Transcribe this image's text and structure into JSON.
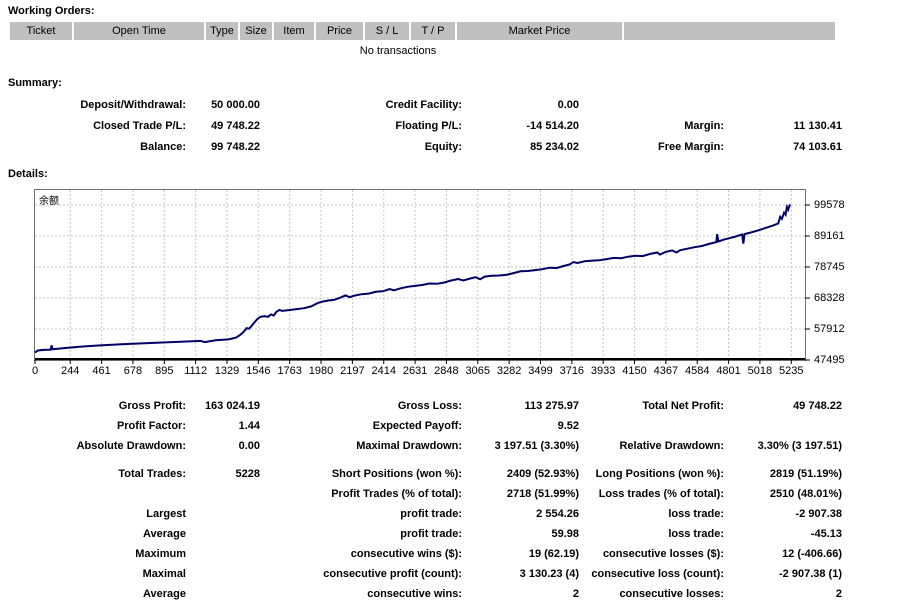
{
  "working_orders": {
    "section_label": "Working Orders:",
    "columns": [
      "Ticket",
      "Open Time",
      "Type",
      "Size",
      "Item",
      "Price",
      "S / L",
      "T / P",
      "Market Price",
      ""
    ],
    "empty_text": "No transactions"
  },
  "summary": {
    "section_label": "Summary:",
    "rows": [
      [
        "Deposit/Withdrawal:",
        "50 000.00",
        "Credit Facility:",
        "0.00",
        "",
        ""
      ],
      [
        "Closed Trade P/L:",
        "49 748.22",
        "Floating P/L:",
        "-14 514.20",
        "Margin:",
        "11 130.41"
      ],
      [
        "Balance:",
        "99 748.22",
        "Equity:",
        "85 234.02",
        "Free Margin:",
        "74 103.61"
      ]
    ]
  },
  "details": {
    "section_label": "Details:"
  },
  "chart_data": {
    "type": "line",
    "title": "",
    "legend": "余额",
    "line_color": "#000066",
    "grid": true,
    "legend_position": "top-left inside plot",
    "xlabel": "",
    "ylabel": "",
    "xlim": [
      0,
      5330
    ],
    "ylim": [
      47495,
      104609
    ],
    "xticks": [
      0,
      244,
      461,
      678,
      895,
      1112,
      1329,
      1546,
      1763,
      1980,
      2197,
      2414,
      2631,
      2848,
      3065,
      3282,
      3499,
      3716,
      3933,
      4150,
      4367,
      4584,
      4801,
      5018,
      5235
    ],
    "yticks": [
      47495,
      57912,
      68328,
      78745,
      89161,
      99578
    ],
    "series": [
      {
        "name": "余额",
        "points": [
          [
            0,
            50000
          ],
          [
            20,
            50700
          ],
          [
            60,
            50900
          ],
          [
            108,
            51000
          ],
          [
            115,
            52400
          ],
          [
            122,
            51100
          ],
          [
            200,
            51500
          ],
          [
            320,
            52000
          ],
          [
            450,
            52400
          ],
          [
            600,
            52800
          ],
          [
            760,
            53100
          ],
          [
            900,
            53400
          ],
          [
            1050,
            53700
          ],
          [
            1145,
            53900
          ],
          [
            1175,
            53500
          ],
          [
            1250,
            54100
          ],
          [
            1340,
            54400
          ],
          [
            1390,
            55000
          ],
          [
            1420,
            55900
          ],
          [
            1445,
            57000
          ],
          [
            1465,
            58200
          ],
          [
            1482,
            58000
          ],
          [
            1500,
            59000
          ],
          [
            1520,
            60200
          ],
          [
            1540,
            61300
          ],
          [
            1560,
            62000
          ],
          [
            1590,
            62200
          ],
          [
            1612,
            62000
          ],
          [
            1635,
            62800
          ],
          [
            1652,
            62400
          ],
          [
            1672,
            63700
          ],
          [
            1692,
            64300
          ],
          [
            1712,
            64000
          ],
          [
            1762,
            64300
          ],
          [
            1812,
            64600
          ],
          [
            1862,
            64900
          ],
          [
            1912,
            65500
          ],
          [
            1956,
            66600
          ],
          [
            1990,
            67100
          ],
          [
            2030,
            67500
          ],
          [
            2070,
            67700
          ],
          [
            2110,
            68400
          ],
          [
            2150,
            69200
          ],
          [
            2176,
            68600
          ],
          [
            2210,
            69100
          ],
          [
            2260,
            69600
          ],
          [
            2310,
            69800
          ],
          [
            2360,
            70400
          ],
          [
            2410,
            70600
          ],
          [
            2455,
            71300
          ],
          [
            2486,
            70900
          ],
          [
            2530,
            71600
          ],
          [
            2580,
            72100
          ],
          [
            2630,
            72400
          ],
          [
            2680,
            72700
          ],
          [
            2730,
            73200
          ],
          [
            2780,
            73100
          ],
          [
            2830,
            73500
          ],
          [
            2880,
            74200
          ],
          [
            2930,
            74700
          ],
          [
            2965,
            74200
          ],
          [
            3000,
            74700
          ],
          [
            3050,
            75300
          ],
          [
            3082,
            74600
          ],
          [
            3112,
            75500
          ],
          [
            3162,
            75800
          ],
          [
            3212,
            75900
          ],
          [
            3262,
            76100
          ],
          [
            3312,
            76700
          ],
          [
            3362,
            77300
          ],
          [
            3412,
            77400
          ],
          [
            3462,
            77700
          ],
          [
            3512,
            78000
          ],
          [
            3562,
            78500
          ],
          [
            3612,
            78400
          ],
          [
            3662,
            79100
          ],
          [
            3702,
            79600
          ],
          [
            3726,
            80400
          ],
          [
            3756,
            80100
          ],
          [
            3806,
            80700
          ],
          [
            3856,
            80900
          ],
          [
            3906,
            81000
          ],
          [
            3956,
            81400
          ],
          [
            4006,
            81800
          ],
          [
            4056,
            81700
          ],
          [
            4106,
            82200
          ],
          [
            4156,
            82500
          ],
          [
            4206,
            82400
          ],
          [
            4256,
            83100
          ],
          [
            4306,
            83600
          ],
          [
            4326,
            82900
          ],
          [
            4360,
            83700
          ],
          [
            4410,
            84300
          ],
          [
            4440,
            83600
          ],
          [
            4466,
            84400
          ],
          [
            4516,
            84900
          ],
          [
            4566,
            85400
          ],
          [
            4616,
            85800
          ],
          [
            4666,
            86500
          ],
          [
            4716,
            87100
          ],
          [
            4722,
            89800
          ],
          [
            4730,
            87300
          ],
          [
            4766,
            87900
          ],
          [
            4806,
            88400
          ],
          [
            4850,
            89000
          ],
          [
            4895,
            89700
          ],
          [
            4903,
            86600
          ],
          [
            4912,
            89800
          ],
          [
            4960,
            90400
          ],
          [
            5010,
            91100
          ],
          [
            5060,
            91900
          ],
          [
            5110,
            92700
          ],
          [
            5145,
            93400
          ],
          [
            5158,
            95600
          ],
          [
            5170,
            94900
          ],
          [
            5185,
            97000
          ],
          [
            5196,
            96300
          ],
          [
            5205,
            98900
          ],
          [
            5214,
            98000
          ],
          [
            5222,
            99300
          ],
          [
            5228,
            99748
          ]
        ]
      }
    ]
  },
  "stats": {
    "rows": [
      [
        "Gross Profit:",
        "163 024.19",
        "Gross Loss:",
        "113 275.97",
        "Total Net Profit:",
        "49 748.22"
      ],
      [
        "Profit Factor:",
        "1.44",
        "Expected Payoff:",
        "9.52",
        "",
        ""
      ],
      [
        "Absolute Drawdown:",
        "0.00",
        "Maximal Drawdown:",
        "3 197.51 (3.30%)",
        "Relative Drawdown:",
        "3.30% (3 197.51)"
      ],
      [
        "Total Trades:",
        "5228",
        "Short Positions (won %):",
        "2409 (52.93%)",
        "Long Positions (won %):",
        "2819 (51.19%)"
      ],
      [
        "",
        "",
        "Profit Trades (% of total):",
        "2718 (51.99%)",
        "Loss trades (% of total):",
        "2510 (48.01%)"
      ],
      [
        "Largest",
        "",
        "profit trade:",
        "2 554.26",
        "loss trade:",
        "-2 907.38"
      ],
      [
        "Average",
        "",
        "profit trade:",
        "59.98",
        "loss trade:",
        "-45.13"
      ],
      [
        "Maximum",
        "",
        "consecutive wins ($):",
        "19 (62.19)",
        "consecutive losses ($):",
        "12 (-406.66)"
      ],
      [
        "Maximal",
        "",
        "consecutive profit (count):",
        "3 130.23 (4)",
        "consecutive loss (count):",
        "-2 907.38 (1)"
      ],
      [
        "Average",
        "",
        "consecutive wins:",
        "2",
        "consecutive losses:",
        "2"
      ]
    ]
  }
}
